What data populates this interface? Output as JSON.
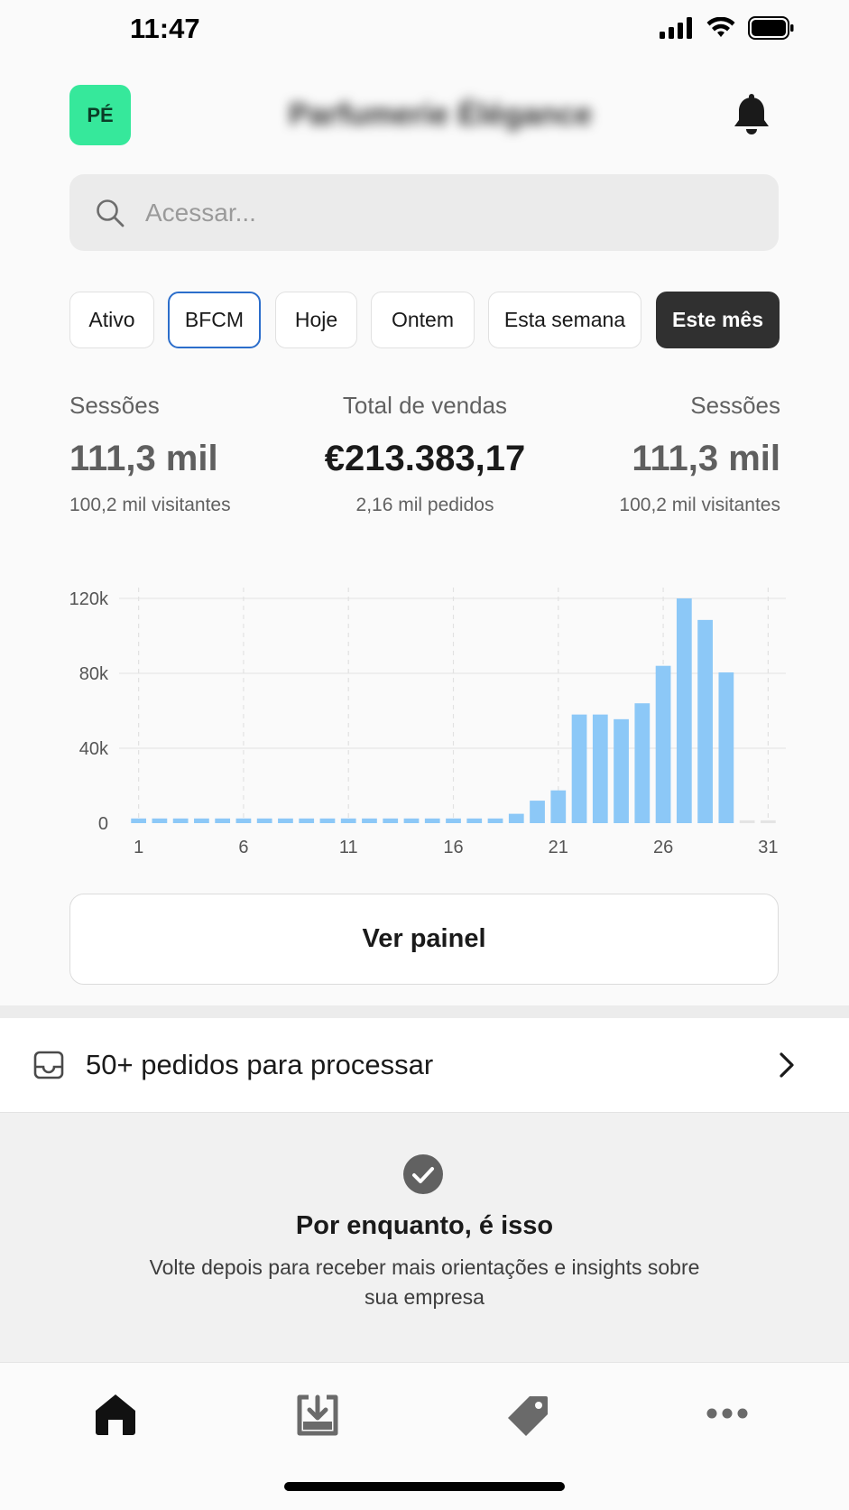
{
  "status_bar": {
    "time": "11:47",
    "icons": [
      "signal-icon",
      "wifi-icon",
      "battery-icon"
    ]
  },
  "header": {
    "avatar_initials": "PÉ",
    "store_name": "Parfumerie Élégance",
    "bell_icon": "bell-icon"
  },
  "search": {
    "placeholder": "Acessar...",
    "value": ""
  },
  "filters": [
    {
      "label": "Ativo",
      "state": "default"
    },
    {
      "label": "BFCM",
      "state": "outlined"
    },
    {
      "label": "Hoje",
      "state": "default"
    },
    {
      "label": "Ontem",
      "state": "default"
    },
    {
      "label": "Esta semana",
      "state": "default"
    },
    {
      "label": "Este mês",
      "state": "selected"
    }
  ],
  "metrics": [
    {
      "label": "Sessões",
      "value": "111,3 mil",
      "sub": "100,2 mil visitantes"
    },
    {
      "label": "Total de vendas",
      "value": "€213.383,17",
      "sub": "2,16 mil pedidos"
    },
    {
      "label": "Sessões",
      "value": "111,3 mil",
      "sub": "100,2 mil visitantes"
    }
  ],
  "chart_data": {
    "type": "bar",
    "x_ticks": [
      "1",
      "6",
      "11",
      "16",
      "21",
      "26",
      "31"
    ],
    "y_ticks": [
      "0",
      "40k",
      "80k",
      "120k"
    ],
    "ylim": [
      0,
      120000
    ],
    "categories": [
      1,
      2,
      3,
      4,
      5,
      6,
      7,
      8,
      9,
      10,
      11,
      12,
      13,
      14,
      15,
      16,
      17,
      18,
      19,
      20,
      21,
      22,
      23,
      24,
      25,
      26,
      27,
      28,
      29,
      30,
      31
    ],
    "values": [
      2500,
      2500,
      2500,
      2500,
      2500,
      2500,
      2500,
      2500,
      2500,
      2500,
      2500,
      2500,
      2500,
      2500,
      2500,
      2500,
      2500,
      2500,
      5000,
      12000,
      17500,
      58000,
      58000,
      55500,
      64000,
      84000,
      120000,
      108500,
      80500,
      1500,
      1500
    ],
    "bar_color": "#8cc8f7",
    "future_bar_color": "#e4e4e4"
  },
  "button": {
    "label": "Ver painel"
  },
  "orders": {
    "label": "50+ pedidos para processar",
    "icon": "inbox-icon"
  },
  "empty_state": {
    "title": "Por enquanto, é isso",
    "description": "Volte depois para receber mais orientações e insights sobre sua empresa",
    "icon": "check-circle-icon"
  },
  "tab_bar": {
    "items": [
      "home-icon",
      "orders-download-icon",
      "tag-icon",
      "more-icon"
    ]
  }
}
